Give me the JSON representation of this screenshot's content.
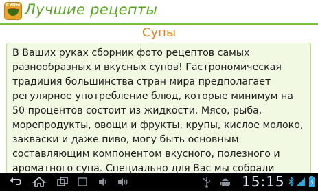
{
  "app": {
    "icon_label": "СУПЫ",
    "title": "Лучшие рецепты"
  },
  "section": {
    "title": "Супы"
  },
  "article": {
    "text": "В Ваших руках сборник фото рецептов самых разнообразных и вкусных супов! Гастрономическая традиция большинства стран мира предполагает регулярное употребление блюд, которые минимум на 50 процентов состоит из жидкости. Мясо, рыба, морепродукты, овощи и фрукты, крупы, кислое молоко, закваски и даже пиво, могу быть основным составляющим компонентом вкусного, полезного и ароматного супа. Специально для Вас мы собрали"
  },
  "system_bar": {
    "clock": "15:15",
    "icons": [
      "back-icon",
      "home-icon",
      "recent-apps-icon",
      "screenshot-icon",
      "volume-down-icon",
      "volume-up-icon",
      "usb-icon",
      "android-debug-icon",
      "bluetooth-icon",
      "wifi-icon",
      "battery-icon"
    ]
  },
  "colors": {
    "brand_green": "#58a51f",
    "section_orange": "#e0841a",
    "card_background": "#f1f9e3"
  }
}
